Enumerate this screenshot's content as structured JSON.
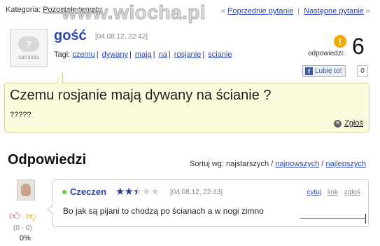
{
  "top": {
    "category_label": "Kategoria:",
    "category_link": "Pozostałe tematy",
    "watermark": "www.wiocha.pl",
    "prev_question": "Poprzednie pytanie",
    "next_question": "Następne pytanie",
    "left_arrows": "«",
    "right_arrows": "»",
    "separator": "|"
  },
  "question": {
    "avatar_site": "samosia",
    "avatar_glyph": "?",
    "author": "gość",
    "date": "[04.08.12, 22:42]",
    "tags_label": "Tagi:",
    "tags": [
      "czemu",
      "dywany",
      "mają",
      "na",
      "rosjanie",
      "scianie"
    ],
    "answers_label": "odpowiedzi:",
    "answers_count": "6",
    "status_icon": "!",
    "like_label": "Lubię to!",
    "like_count": "0",
    "title": "Czemu rosjanie mają dywany na ścianie ?",
    "body": "?????",
    "report_label": "Zgłoś"
  },
  "answers_section": {
    "title": "Odpowiedzi",
    "sort_label": "Sortuj wg:",
    "sort_oldest": "najstarszych",
    "sort_newest": "najnowszych",
    "sort_best": "najlepszych",
    "sort_sep": "/"
  },
  "answer": {
    "author": "Czeczen",
    "rating_stars": 2.5,
    "rating_max": 5,
    "date": "[04.08.12, 22:43]",
    "action_quote": "cytuj",
    "action_link": "link",
    "action_report": "zgłoś",
    "text": "Bo jak są pijani to chodzą po ścianach a w nogi zimno",
    "votes": "(0 - 0)",
    "percent": "0%"
  },
  "colors": {
    "link_blue": "#2a46b5",
    "question_bg": "#fdfbdd",
    "question_border": "#d6d09a",
    "accent_orange": "#f0a800",
    "facebook_blue": "#3b5998"
  }
}
